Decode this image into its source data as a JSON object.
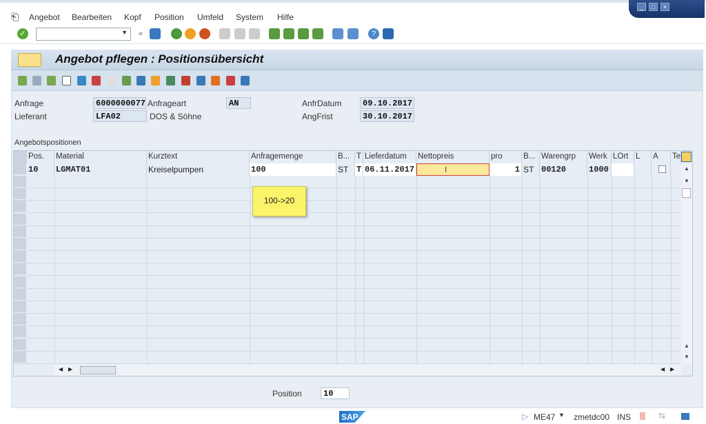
{
  "menu": {
    "items": [
      "Angebot",
      "Bearbeiten",
      "Kopf",
      "Position",
      "Umfeld",
      "System",
      "Hilfe"
    ]
  },
  "toolbar": {
    "command_value": ""
  },
  "screen": {
    "title": "Angebot pflegen : Positionsübersicht"
  },
  "header": {
    "anfrage_label": "Anfrage",
    "anfrage": "6000000077",
    "anfrageart_label": "Anfrageart",
    "anfrageart": "AN",
    "anfrdatum_label": "AnfrDatum",
    "anfrdatum": "09.10.2017",
    "lieferant_label": "Lieferant",
    "lieferant": "LFA02",
    "lieferant_name": "DOS & Söhne",
    "angfrist_label": "AngFrist",
    "angfrist": "30.10.2017"
  },
  "table": {
    "title": "Angebotspositionen",
    "columns": [
      "Pos.",
      "Material",
      "Kurztext",
      "Anfragemenge",
      "B...",
      "T",
      "Lieferdatum",
      "Nettopreis",
      "pro",
      "B...",
      "Warengrp",
      "Werk",
      "LOrt",
      "L",
      "A",
      "Te"
    ],
    "rows": [
      {
        "pos": "10",
        "material": "LGMAT01",
        "kurztext": "Kreiselpumpen",
        "menge": "100",
        "bme": "ST",
        "t": "T",
        "lieferdatum": "06.11.2017",
        "nettopreis": "",
        "pro": "1",
        "bpe": "ST",
        "warengrp": "00120",
        "werk": "1000",
        "lort": "",
        "l": "",
        "a": false
      }
    ]
  },
  "note": {
    "text": "100->20"
  },
  "footer": {
    "position_label": "Position",
    "position_value": "10"
  },
  "status": {
    "transaction": "ME47",
    "server": "zmetdc00",
    "mode": "INS",
    "logo": "SAP"
  }
}
